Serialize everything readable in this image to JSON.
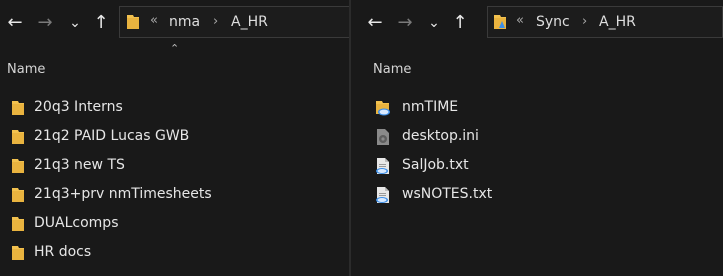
{
  "left_window": {
    "breadcrumb": [
      "nma",
      "A_HR"
    ],
    "breadcrumb_overflow": "«",
    "column_header": "Name",
    "items": [
      {
        "label": "20q3 Interns",
        "type": "folder"
      },
      {
        "label": "21q2 PAID Lucas GWB",
        "type": "folder"
      },
      {
        "label": "21q3 new TS",
        "type": "folder"
      },
      {
        "label": "21q3+prv nmTimesheets",
        "type": "folder"
      },
      {
        "label": "DUALcomps",
        "type": "folder"
      },
      {
        "label": "HR docs",
        "type": "folder"
      }
    ]
  },
  "right_window": {
    "breadcrumb": [
      "Sync",
      "A_HR"
    ],
    "breadcrumb_overflow": "«",
    "column_header": "Name",
    "items": [
      {
        "label": "nmTIME",
        "type": "sync-folder"
      },
      {
        "label": "desktop.ini",
        "type": "settings-file"
      },
      {
        "label": "SalJob.txt",
        "type": "text-file"
      },
      {
        "label": "wsNOTES.txt",
        "type": "text-file"
      }
    ]
  },
  "nav": {
    "back": "←",
    "forward": "→",
    "recent": "⌄",
    "up": "↑"
  },
  "colors": {
    "background": "#191919",
    "folder_yellow": "#f2c14e",
    "folder_dark": "#d9a032",
    "sync_blue": "#3b8ee8",
    "text": "#e6e6e6"
  }
}
